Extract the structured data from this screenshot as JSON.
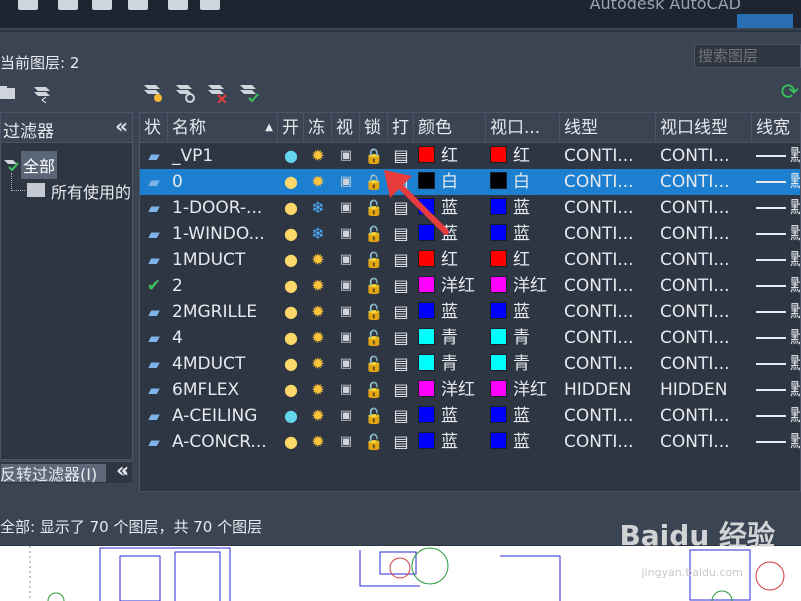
{
  "current_layer": "当前图层: 2",
  "search": {
    "placeholder": "搜索图层"
  },
  "filter_panel": {
    "header": "过滤器",
    "collapse_glyph": "«",
    "tree_all": "全部",
    "tree_used": "所有使用的图层",
    "invert_label": "反转过滤器(I)",
    "collapse2_glyph": "«",
    "scroll_arrow": "›"
  },
  "columns": [
    "状",
    "名称",
    "开",
    "冻",
    "视",
    "锁",
    "打",
    "颜色",
    "视口...",
    "线型",
    "视口线型",
    "线宽"
  ],
  "layers": [
    {
      "status": "layer",
      "name": "_VP1",
      "on": "cyan",
      "freeze": "sun",
      "locked": true,
      "color": "红",
      "color_hex": "#ff0000",
      "vp_color": "红",
      "vp_color_hex": "#ff0000",
      "linetype": "CONTI...",
      "vp_linetype": "CONTI...",
      "lineweight": "默"
    },
    {
      "status": "layer",
      "name": "0",
      "on": "yellow",
      "freeze": "sun",
      "locked": true,
      "color": "白",
      "color_hex": "#000000",
      "vp_color": "白",
      "vp_color_hex": "#000000",
      "linetype": "CONTI...",
      "vp_linetype": "CONTI...",
      "lineweight": "默",
      "selected": true
    },
    {
      "status": "layer",
      "name": "1-DOOR-...",
      "on": "yellow",
      "freeze": "snow",
      "locked": false,
      "color": "蓝",
      "color_hex": "#0000ff",
      "vp_color": "蓝",
      "vp_color_hex": "#0000ff",
      "linetype": "CONTI...",
      "vp_linetype": "CONTI...",
      "lineweight": "默"
    },
    {
      "status": "layer",
      "name": "1-WINDO...",
      "on": "yellow",
      "freeze": "snow",
      "locked": false,
      "color": "蓝",
      "color_hex": "#0000ff",
      "vp_color": "蓝",
      "vp_color_hex": "#0000ff",
      "linetype": "CONTI...",
      "vp_linetype": "CONTI...",
      "lineweight": "默"
    },
    {
      "status": "layer",
      "name": "1MDUCT",
      "on": "yellow",
      "freeze": "sun",
      "locked": false,
      "color": "红",
      "color_hex": "#ff0000",
      "vp_color": "红",
      "vp_color_hex": "#ff0000",
      "linetype": "CONTI...",
      "vp_linetype": "CONTI...",
      "lineweight": "默"
    },
    {
      "status": "current",
      "name": "2",
      "on": "yellow",
      "freeze": "sun",
      "locked": false,
      "color": "洋红",
      "color_hex": "#ff00ff",
      "vp_color": "洋红",
      "vp_color_hex": "#ff00ff",
      "linetype": "CONTI...",
      "vp_linetype": "CONTI...",
      "lineweight": "默"
    },
    {
      "status": "layer",
      "name": "2MGRILLE",
      "on": "yellow",
      "freeze": "sun",
      "locked": false,
      "color": "蓝",
      "color_hex": "#0000ff",
      "vp_color": "蓝",
      "vp_color_hex": "#0000ff",
      "linetype": "CONTI...",
      "vp_linetype": "CONTI...",
      "lineweight": "默"
    },
    {
      "status": "layer",
      "name": "4",
      "on": "yellow",
      "freeze": "sun",
      "locked": false,
      "color": "青",
      "color_hex": "#00ffff",
      "vp_color": "青",
      "vp_color_hex": "#00ffff",
      "linetype": "CONTI...",
      "vp_linetype": "CONTI...",
      "lineweight": "默"
    },
    {
      "status": "layer",
      "name": "4MDUCT",
      "on": "yellow",
      "freeze": "sun",
      "locked": false,
      "color": "青",
      "color_hex": "#00ffff",
      "vp_color": "青",
      "vp_color_hex": "#00ffff",
      "linetype": "CONTI...",
      "vp_linetype": "CONTI...",
      "lineweight": "默"
    },
    {
      "status": "layer",
      "name": "6MFLEX",
      "on": "yellow",
      "freeze": "sun",
      "locked": false,
      "color": "洋红",
      "color_hex": "#ff00ff",
      "vp_color": "洋红",
      "vp_color_hex": "#ff00ff",
      "linetype": "HIDDEN",
      "vp_linetype": "HIDDEN",
      "lineweight": "默"
    },
    {
      "status": "layer",
      "name": "A-CEILING",
      "on": "cyan",
      "freeze": "sun",
      "locked": false,
      "color": "蓝",
      "color_hex": "#0000ff",
      "vp_color": "蓝",
      "vp_color_hex": "#0000ff",
      "linetype": "CONTI...",
      "vp_linetype": "CONTI...",
      "lineweight": "默"
    },
    {
      "status": "layer",
      "name": "A-CONCR...",
      "on": "yellow",
      "freeze": "sun",
      "locked": false,
      "color": "蓝",
      "color_hex": "#0000ff",
      "vp_color": "蓝",
      "vp_color_hex": "#0000ff",
      "linetype": "CONTI...",
      "vp_linetype": "CONTI...",
      "lineweight": "默"
    }
  ],
  "glyphs": {
    "status_layer": "▰",
    "status_current": "✔",
    "bulb": "●",
    "sun": "✹",
    "snow": "❄",
    "vp": "▣",
    "lock": "🔓",
    "locked": "🔒",
    "printer": "▤",
    "refresh": "⟳",
    "sort": "▲",
    "scroll_left": "‹"
  },
  "status_bar": "全部: 显示了 70 个图层，共 70 个图层",
  "app_title": "Autodesk AutoCAD",
  "watermark": "Baidu 经验",
  "watermark_sub": "jingyan.baidu.com"
}
